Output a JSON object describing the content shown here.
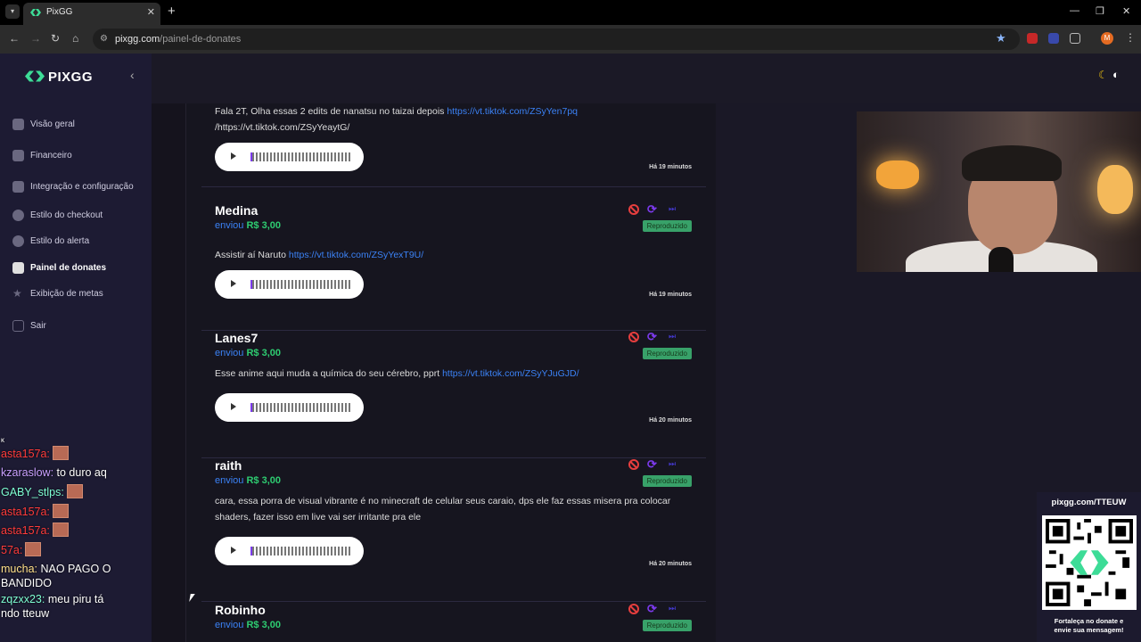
{
  "browser": {
    "tab_title": "PixGG",
    "url_domain": "pixgg.com",
    "url_path": "/painel-de-donates",
    "avatar_initial": "M"
  },
  "sidebar": {
    "logo": "PIXGG",
    "items": [
      {
        "label": "Visão geral",
        "icon": "home-icon"
      },
      {
        "label": "Financeiro",
        "icon": "wallet-icon"
      },
      {
        "label": "Integração e configuração",
        "icon": "integration-icon"
      },
      {
        "label": "Estilo do checkout",
        "icon": "palette-icon"
      },
      {
        "label": "Estilo do alerta",
        "icon": "palette-icon"
      },
      {
        "label": "Painel de donates",
        "icon": "donate-hand-icon"
      },
      {
        "label": "Exibição de metas",
        "icon": "star-icon"
      },
      {
        "label": "Sair",
        "icon": "logout-icon"
      }
    ]
  },
  "feed": {
    "verb": "enviou",
    "status": "Reproduzido",
    "donations": [
      {
        "name": "",
        "amount": "",
        "message": "Fala 2T, Olha essas 2 edits de nanatsu no taizai depois ",
        "link": "https://vt.tiktok.com/ZSyYen7pq",
        "message2": "/https://vt.tiktok.com/ZSyYeaytG/",
        "time": "Há 19 minutos"
      },
      {
        "name": "Medina",
        "amount": "R$ 3,00",
        "message": "Assistir aí Naruto ",
        "link": "https://vt.tiktok.com/ZSyYexT9U/",
        "message2": "",
        "time": "Há 19 minutos"
      },
      {
        "name": "Lanes7",
        "amount": "R$ 3,00",
        "message": "Esse anime aqui muda a química do seu cérebro, pprt ",
        "link": "https://vt.tiktok.com/ZSyYJuGJD/",
        "message2": "",
        "time": "Há 20 minutos"
      },
      {
        "name": "raith",
        "amount": "R$ 3,00",
        "message": "cara, essa porra de visual vibrante é no minecraft de celular seus caraio, dps ele faz essas misera pra colocar shaders, fazer isso em live vai ser irritante pra ele",
        "link": "",
        "message2": "",
        "time": "Há 20 minutos"
      },
      {
        "name": "Robinho",
        "amount": "R$ 3,00",
        "message": "",
        "link": "",
        "message2": "",
        "time": ""
      }
    ]
  },
  "chat": [
    {
      "user": "ĸ",
      "text": "",
      "user_color": "#ffffff"
    },
    {
      "user": "asta157a:",
      "text": "",
      "user_color": "#ff3b3b",
      "emote": true
    },
    {
      "user": "kzaraslow:",
      "text": "to duro aq",
      "user_color": "#c9a0ff"
    },
    {
      "user": "GABY_stlps:",
      "text": "",
      "user_color": "#7fffd4",
      "emote": true
    },
    {
      "user": "asta157a:",
      "text": "",
      "user_color": "#ff3b3b",
      "emote": true
    },
    {
      "user": "asta157a:",
      "text": "",
      "user_color": "#ff3b3b",
      "emote": true
    },
    {
      "user": "57a:",
      "text": "",
      "user_color": "#ff3b3b",
      "emote": true
    },
    {
      "user": "mucha:",
      "text": "NAO PAGO O",
      "user_color": "#ffe08a"
    },
    {
      "user": "",
      "text": "BANDIDO",
      "user_color": "#ffffff"
    },
    {
      "user": "zqzxx23:",
      "text": "meu piru tá",
      "user_color": "#7fffd4"
    },
    {
      "user": "",
      "text": "ndo tteuw",
      "user_color": "#ffffff"
    }
  ],
  "qr_widget": {
    "url": "pixgg.com/TTEUW",
    "caption_line1": "Fortaleça no donate e",
    "caption_line2": "envie sua mensagem!"
  },
  "colors": {
    "accent_green": "#2ecc71",
    "accent_blue": "#3b82f6",
    "status_bg": "#38a169",
    "sidebar_bg": "#1d1b33"
  }
}
